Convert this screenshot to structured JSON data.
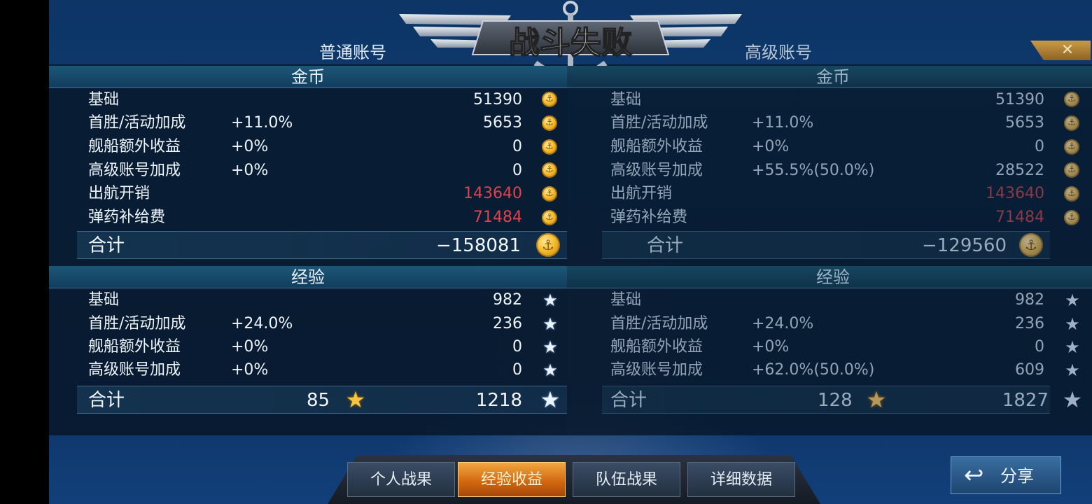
{
  "header": {
    "title": "战斗失败",
    "tab_normal": "普通账号",
    "tab_premium": "高级账号",
    "close": "✕"
  },
  "normal": {
    "gold": {
      "section": "金币",
      "rows": [
        {
          "label": "基础",
          "pct": "",
          "value": "51390",
          "negative": false
        },
        {
          "label": "首胜/活动加成",
          "pct": "+11.0%",
          "value": "5653",
          "negative": false
        },
        {
          "label": "舰船额外收益",
          "pct": "+0%",
          "value": "0",
          "negative": false
        },
        {
          "label": "高级账号加成",
          "pct": "+0%",
          "value": "0",
          "negative": false
        },
        {
          "label": "出航开销",
          "pct": "",
          "value": "143640",
          "negative": true
        },
        {
          "label": "弹药补给费",
          "pct": "",
          "value": "71484",
          "negative": true
        }
      ],
      "total_label": "合计",
      "total_value": "−158081"
    },
    "exp": {
      "section": "经验",
      "rows": [
        {
          "label": "基础",
          "pct": "",
          "value": "982"
        },
        {
          "label": "首胜/活动加成",
          "pct": "+24.0%",
          "value": "236"
        },
        {
          "label": "舰船额外收益",
          "pct": "+0%",
          "value": "0"
        },
        {
          "label": "高级账号加成",
          "pct": "+0%",
          "value": "0"
        }
      ],
      "total_label": "合计",
      "total_captain": "85",
      "total_value": "1218"
    }
  },
  "premium": {
    "gold": {
      "section": "金币",
      "rows": [
        {
          "label": "基础",
          "pct": "",
          "value": "51390",
          "negative": false
        },
        {
          "label": "首胜/活动加成",
          "pct": "+11.0%",
          "value": "5653",
          "negative": false
        },
        {
          "label": "舰船额外收益",
          "pct": "+0%",
          "value": "0",
          "negative": false
        },
        {
          "label": "高级账号加成",
          "pct": "+55.5%(50.0%)",
          "value": "28522",
          "negative": false
        },
        {
          "label": "出航开销",
          "pct": "",
          "value": "143640",
          "negative": true
        },
        {
          "label": "弹药补给费",
          "pct": "",
          "value": "71484",
          "negative": true
        }
      ],
      "total_label": "合计",
      "total_value": "−129560"
    },
    "exp": {
      "section": "经验",
      "rows": [
        {
          "label": "基础",
          "pct": "",
          "value": "982"
        },
        {
          "label": "首胜/活动加成",
          "pct": "+24.0%",
          "value": "236"
        },
        {
          "label": "舰船额外收益",
          "pct": "+0%",
          "value": "0"
        },
        {
          "label": "高级账号加成",
          "pct": "+62.0%(50.0%)",
          "value": "609"
        }
      ],
      "total_label": "合计",
      "total_captain": "128",
      "total_value": "1827"
    }
  },
  "bottom_tabs": [
    {
      "label": "个人战果",
      "active": false
    },
    {
      "label": "经验收益",
      "active": true
    },
    {
      "label": "队伍战果",
      "active": false
    },
    {
      "label": "详细数据",
      "active": false
    }
  ],
  "share": {
    "label": "分享",
    "icon": "share-arrow-icon"
  },
  "colors": {
    "negative": "#e0424e",
    "gold": "#f3bb2c",
    "active_tab": "#d26a10"
  },
  "icons": {
    "coin": "anchor-coin-icon",
    "exp": "star-icon",
    "captain_exp": "gold-star-icon"
  }
}
